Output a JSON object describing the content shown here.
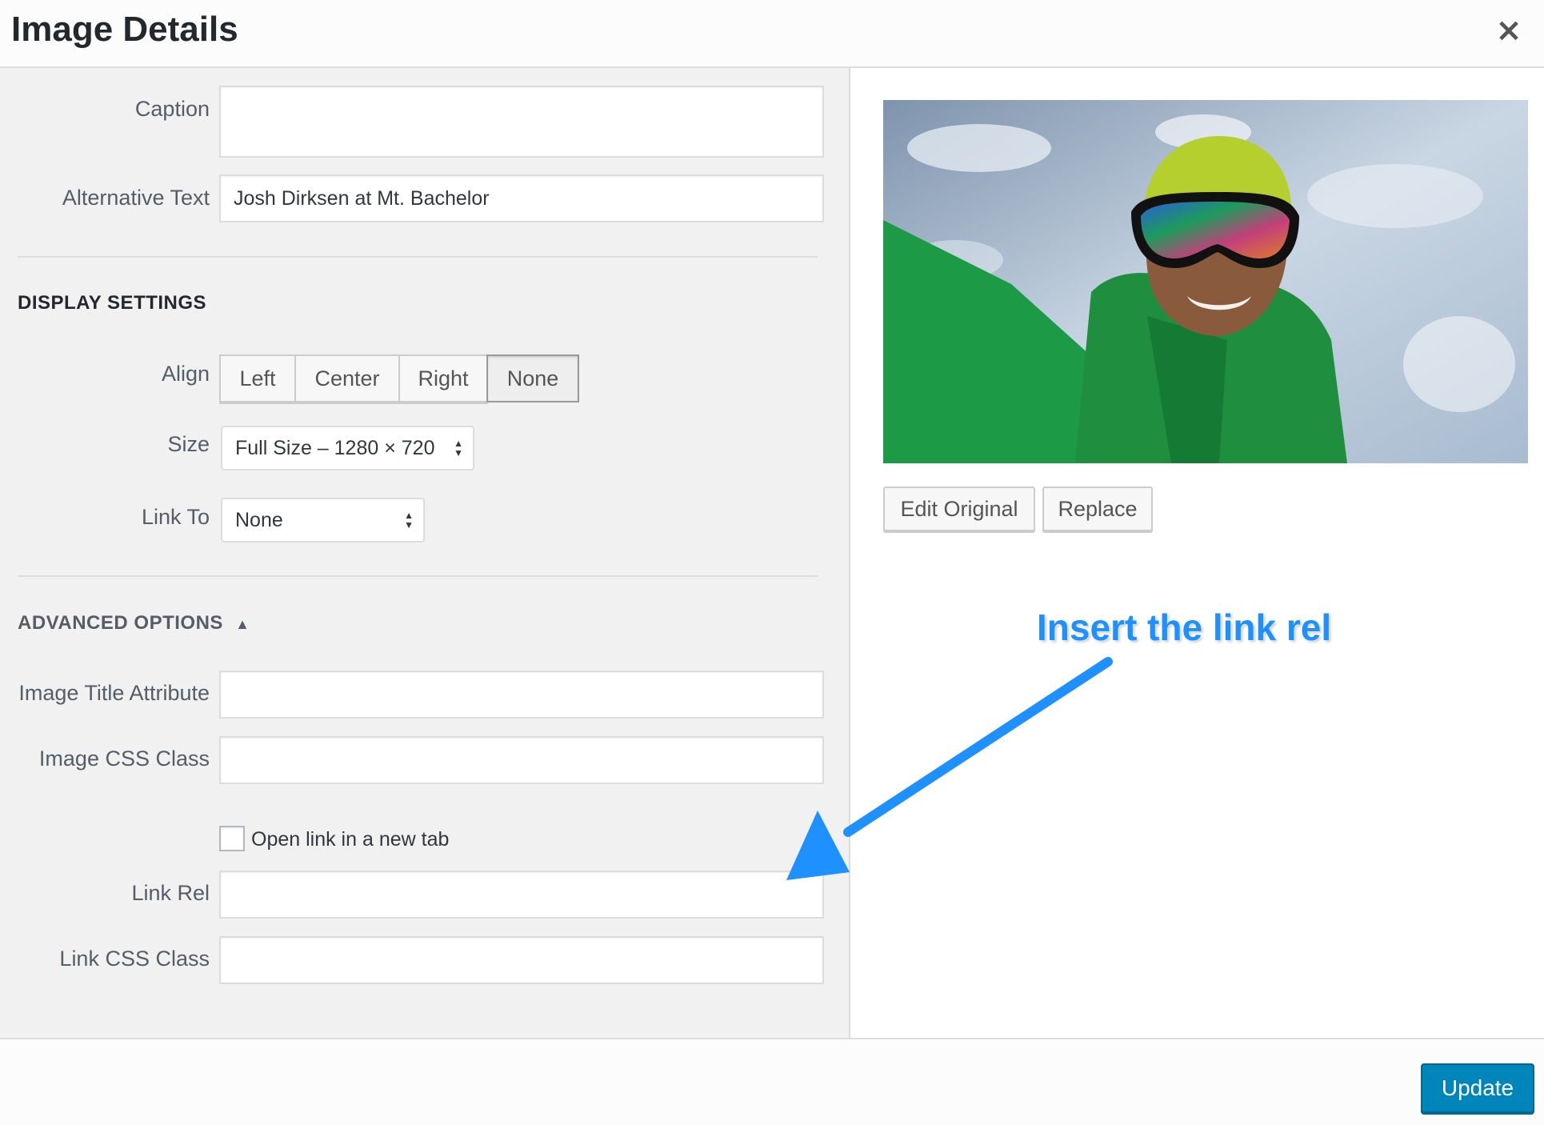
{
  "header": {
    "title": "Image Details",
    "close_label": "×"
  },
  "fields": {
    "caption_label": "Caption",
    "caption_value": "",
    "alt_label": "Alternative Text",
    "alt_value": "Josh Dirksen at Mt. Bachelor"
  },
  "display": {
    "title": "DISPLAY SETTINGS",
    "align_label": "Align",
    "align_options": [
      "Left",
      "Center",
      "Right",
      "None"
    ],
    "align_selected": "None",
    "size_label": "Size",
    "size_value": "Full Size – 1280 × 720",
    "linkto_label": "Link To",
    "linkto_value": "None"
  },
  "advanced": {
    "title": "ADVANCED OPTIONS",
    "toggle_icon": "▲",
    "title_attr_label": "Image Title Attribute",
    "title_attr_value": "",
    "css_class_label": "Image CSS Class",
    "css_class_value": "",
    "new_tab_label": "Open link in a new tab",
    "new_tab_checked": false,
    "link_rel_label": "Link Rel",
    "link_rel_value": "",
    "link_css_label": "Link CSS Class",
    "link_css_value": ""
  },
  "preview": {
    "edit_label": "Edit Original",
    "replace_label": "Replace"
  },
  "annotation": {
    "text": "Insert the link rel",
    "color": "#1e90ff"
  },
  "footer": {
    "update_label": "Update",
    "accent": "#0085ba"
  }
}
